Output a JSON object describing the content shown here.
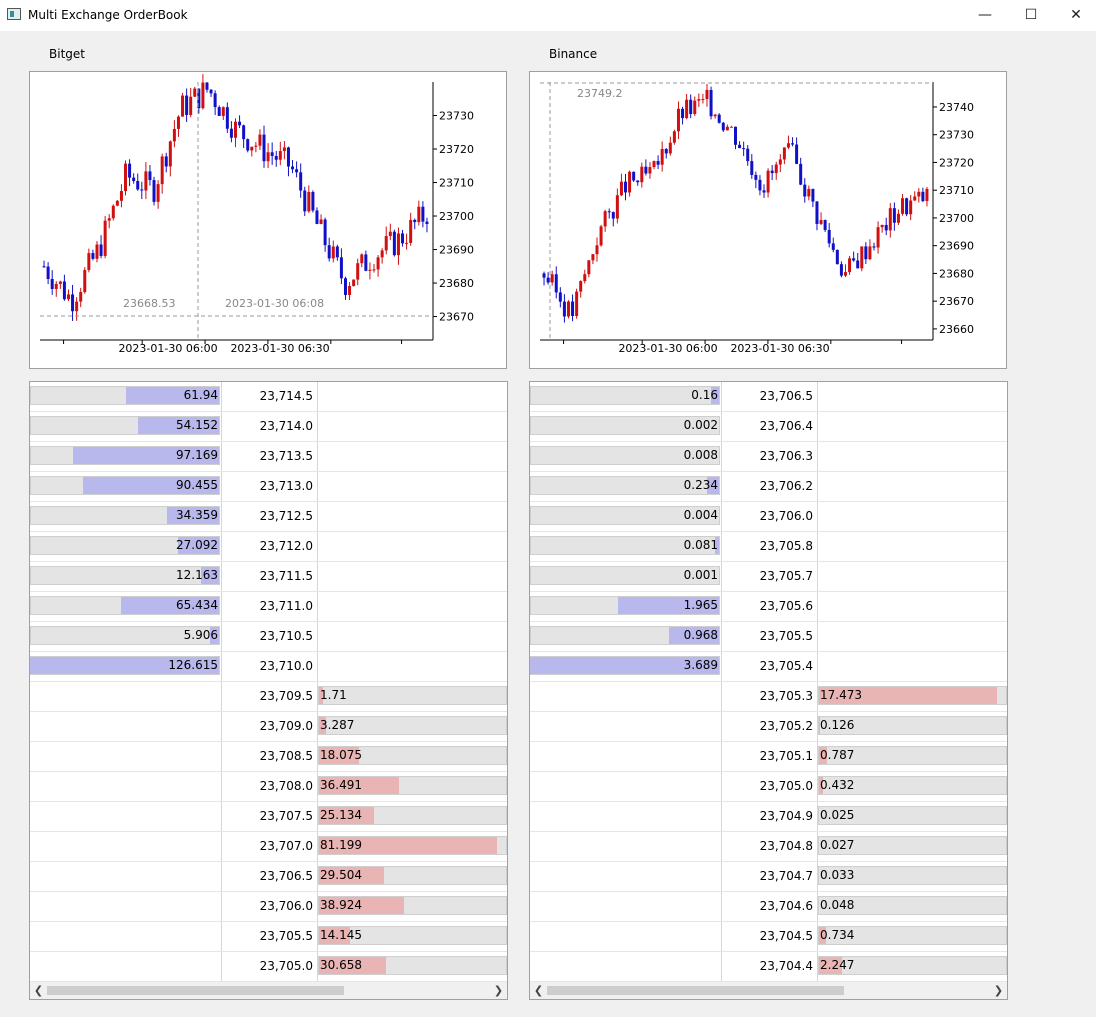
{
  "window": {
    "title": "Multi Exchange OrderBook",
    "minimize_icon": "minimize-icon",
    "maximize_icon": "maximize-icon",
    "close_icon": "close-icon"
  },
  "colors": {
    "bid_fill": "#b8b8ec",
    "ask_fill": "#e9b4b4",
    "bar_bg": "#e4e4e4",
    "candle_up": "#d01010",
    "candle_down": "#1010c8"
  },
  "panels": [
    {
      "exchange": "Bitget",
      "chart": {
        "y_ticks": [
          "23730",
          "23720",
          "23710",
          "23700",
          "23690",
          "23680",
          "23670"
        ],
        "x_ticks": [
          "2023-01-30 06:00",
          "2023-01-30 06:30"
        ],
        "crosshair_price": "23668.53",
        "crosshair_time": "2023-01-30 06:08"
      },
      "bids": [
        {
          "price": "23,714.5",
          "size": "61.94"
        },
        {
          "price": "23,714.0",
          "size": "54.152"
        },
        {
          "price": "23,713.5",
          "size": "97.169"
        },
        {
          "price": "23,713.0",
          "size": "90.455"
        },
        {
          "price": "23,712.5",
          "size": "34.359"
        },
        {
          "price": "23,712.0",
          "size": "27.092"
        },
        {
          "price": "23,711.5",
          "size": "12.163"
        },
        {
          "price": "23,711.0",
          "size": "65.434"
        },
        {
          "price": "23,710.5",
          "size": "5.906"
        },
        {
          "price": "23,710.0",
          "size": "126.615"
        }
      ],
      "asks": [
        {
          "price": "23,709.5",
          "size": "1.71"
        },
        {
          "price": "23,709.0",
          "size": "3.287"
        },
        {
          "price": "23,708.5",
          "size": "18.075"
        },
        {
          "price": "23,708.0",
          "size": "36.491"
        },
        {
          "price": "23,707.5",
          "size": "25.134"
        },
        {
          "price": "23,707.0",
          "size": "81.199"
        },
        {
          "price": "23,706.5",
          "size": "29.504"
        },
        {
          "price": "23,706.0",
          "size": "38.924"
        },
        {
          "price": "23,705.5",
          "size": "14.145"
        },
        {
          "price": "23,705.0",
          "size": "30.658"
        }
      ]
    },
    {
      "exchange": "Binance",
      "chart": {
        "y_ticks": [
          "23740",
          "23730",
          "23720",
          "23710",
          "23700",
          "23690",
          "23680",
          "23670",
          "23660"
        ],
        "x_ticks": [
          "2023-01-30 06:00",
          "2023-01-30 06:30"
        ],
        "crosshair_price": "23749.2",
        "crosshair_time": ""
      },
      "bids": [
        {
          "price": "23,706.5",
          "size": "0.16"
        },
        {
          "price": "23,706.4",
          "size": "0.002"
        },
        {
          "price": "23,706.3",
          "size": "0.008"
        },
        {
          "price": "23,706.2",
          "size": "0.234"
        },
        {
          "price": "23,706.0",
          "size": "0.004"
        },
        {
          "price": "23,705.8",
          "size": "0.081"
        },
        {
          "price": "23,705.7",
          "size": "0.001"
        },
        {
          "price": "23,705.6",
          "size": "1.965"
        },
        {
          "price": "23,705.5",
          "size": "0.968"
        },
        {
          "price": "23,705.4",
          "size": "3.689"
        }
      ],
      "asks": [
        {
          "price": "23,705.3",
          "size": "17.473"
        },
        {
          "price": "23,705.2",
          "size": "0.126"
        },
        {
          "price": "23,705.1",
          "size": "0.787"
        },
        {
          "price": "23,705.0",
          "size": "0.432"
        },
        {
          "price": "23,704.9",
          "size": "0.025"
        },
        {
          "price": "23,704.8",
          "size": "0.027"
        },
        {
          "price": "23,704.7",
          "size": "0.033"
        },
        {
          "price": "23,704.6",
          "size": "0.048"
        },
        {
          "price": "23,704.5",
          "size": "0.734"
        },
        {
          "price": "23,704.4",
          "size": "2.247"
        }
      ]
    }
  ]
}
